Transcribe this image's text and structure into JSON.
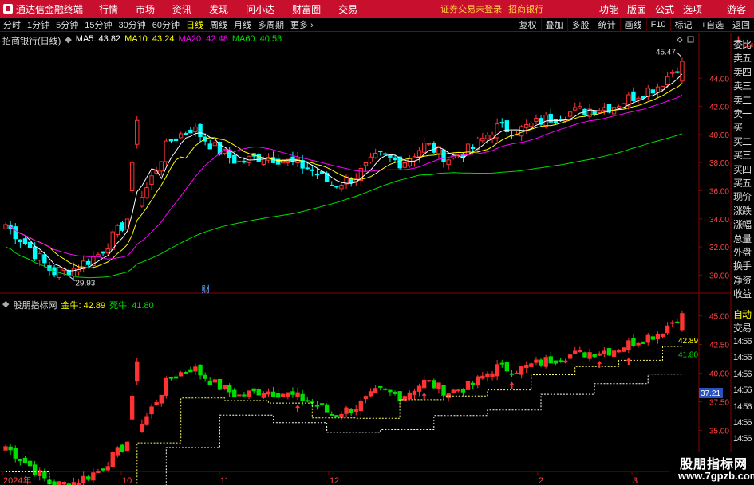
{
  "menubar": {
    "title": "通达信金融终端",
    "menus": [
      "行情",
      "市场",
      "资讯",
      "发现",
      "问小达",
      "财富圈",
      "交易"
    ],
    "status": "证券交易未登录",
    "account": "招商银行",
    "right_menus": [
      "功能",
      "版面",
      "公式",
      "选项"
    ],
    "guest": "游客"
  },
  "periodbar": {
    "periods": [
      "分时",
      "1分钟",
      "5分钟",
      "15分钟",
      "30分钟",
      "60分钟",
      "日线",
      "周线",
      "月线",
      "多周期",
      "更多"
    ],
    "active": "日线",
    "tools": [
      "复权",
      "叠加",
      "多股",
      "统计",
      "画线",
      "F10",
      "标记",
      "+自选",
      "返回"
    ]
  },
  "main": {
    "stock_title": "招商银行(日线)",
    "ma_items": [
      {
        "label": "MA5: 43.82",
        "color": "#ffffff"
      },
      {
        "label": "MA10: 43.24",
        "color": "#ffff00"
      },
      {
        "label": "MA20: 42.48",
        "color": "#ff00ff"
      },
      {
        "label": "MA60: 40.53",
        "color": "#00dd00"
      }
    ],
    "y_ticks": [
      "44.00",
      "42.00",
      "40.00",
      "38.00",
      "36.00",
      "34.00",
      "32.00",
      "30.00"
    ],
    "high_label": "45.47",
    "low_label": "29.93",
    "event_marker": "财",
    "corner_label": "L",
    "corner_sub": "300"
  },
  "indicator": {
    "name": "股朋指标网",
    "items": [
      {
        "label": "金牛: 42.89",
        "color": "#ffff00"
      },
      {
        "label": "死牛: 41.80",
        "color": "#00dd00"
      }
    ],
    "y_ticks": [
      "45.00",
      "42.50",
      "40.00",
      "37.50",
      "35.00",
      "32.50"
    ],
    "value_labels": [
      "42.89",
      "41.80"
    ],
    "cursor_value": "37.21"
  },
  "x_axis": {
    "labels": [
      "2024年",
      "10",
      "11",
      "12",
      "2",
      "3"
    ]
  },
  "side_panel": {
    "items": [
      "委比",
      "卖五",
      "卖四",
      "卖三",
      "卖二",
      "卖一",
      "买一",
      "买二",
      "买三",
      "买四",
      "买五",
      "现价",
      "涨跌",
      "涨幅",
      "总量",
      "外盘",
      "换手",
      "净资",
      "收益",
      "自动",
      "交易",
      "14:56",
      "14:56",
      "14:56",
      "14:56",
      "14:56",
      "14:56",
      "14:56",
      "14:56",
      "14:56"
    ]
  },
  "watermark": {
    "line1": "股朋指标网",
    "line2": "www.7gpzb.com"
  },
  "colors": {
    "up": "#ff3333",
    "down": "#00ffff",
    "ind_up": "#ff3333",
    "ind_down": "#00dd00",
    "grid": "#8a0000",
    "menubar": "#c8102e"
  },
  "chart_data": {
    "type": "candlestick",
    "title": "招商银行(日线)",
    "price_range": [
      29.0,
      46.0
    ],
    "indicator_range": [
      31.5,
      46.5
    ],
    "latest_ma": {
      "MA5": 43.82,
      "MA10": 43.24,
      "MA20": 42.48,
      "MA60": 40.53
    },
    "period_high": 45.47,
    "period_low": 29.93,
    "anchor_closes": [
      33.6,
      32.0,
      30.2,
      30.5,
      31.5,
      33.5,
      36.0,
      39.5,
      40.5,
      39.0,
      38.0,
      38.5,
      38.2,
      37.6,
      36.4,
      37.0,
      38.5,
      38.0,
      39.3,
      38.3,
      39.0,
      40.5,
      40.3,
      41.0,
      41.5,
      41.8,
      42.0,
      42.8,
      43.5,
      45.2
    ]
  }
}
